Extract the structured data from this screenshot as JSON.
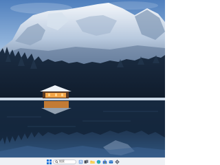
{
  "desktop": {
    "wallpaper": "mountain-lake-cabin-winter"
  },
  "taskbar": {
    "start_icon": "windows-start-icon",
    "search": {
      "icon": "search-icon",
      "value": "搜索"
    },
    "pinned": [
      {
        "name": "widgets",
        "icon": "widgets-icon"
      },
      {
        "name": "task-view",
        "icon": "task-view-icon"
      },
      {
        "name": "file-explorer",
        "icon": "folder-icon"
      },
      {
        "name": "edge",
        "icon": "edge-icon"
      },
      {
        "name": "store",
        "icon": "store-icon"
      },
      {
        "name": "mail",
        "icon": "mail-icon"
      },
      {
        "name": "settings",
        "icon": "gear-icon"
      }
    ],
    "colors": {
      "background": "#eef1f5",
      "accent": "#1a73d9"
    }
  }
}
